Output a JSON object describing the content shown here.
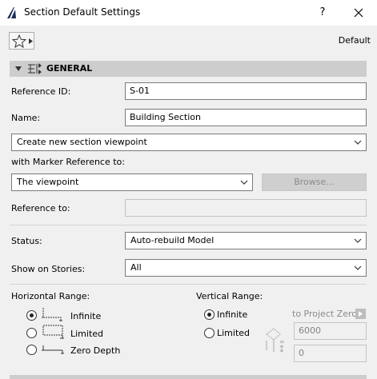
{
  "window": {
    "title": "Section Default Settings",
    "help_label": "?"
  },
  "toolbar": {
    "default_label": "Default"
  },
  "general": {
    "header": "GENERAL",
    "reference_id": {
      "label": "Reference ID:",
      "value": "S-01"
    },
    "name": {
      "label": "Name:",
      "value": "Building Section"
    },
    "viewpoint_option": "Create new section viewpoint",
    "marker_ref": {
      "label": "with Marker Reference to:",
      "value": "The viewpoint",
      "browse_label": "Browse..."
    },
    "reference_to": {
      "label": "Reference to:",
      "value": ""
    },
    "status": {
      "label": "Status:",
      "value": "Auto-rebuild Model"
    },
    "show_on_stories": {
      "label": "Show on Stories:",
      "value": "All"
    }
  },
  "horizontal_range": {
    "label": "Horizontal Range:",
    "options": [
      {
        "label": "Infinite",
        "selected": true
      },
      {
        "label": "Limited",
        "selected": false
      },
      {
        "label": "Zero Depth",
        "selected": false
      }
    ]
  },
  "vertical_range": {
    "label": "Vertical Range:",
    "options": [
      {
        "label": "Infinite",
        "selected": true
      },
      {
        "label": "Limited",
        "selected": false
      }
    ],
    "to_project_zero": "to Project Zero",
    "top_value": "6000",
    "bottom_value": "0"
  }
}
